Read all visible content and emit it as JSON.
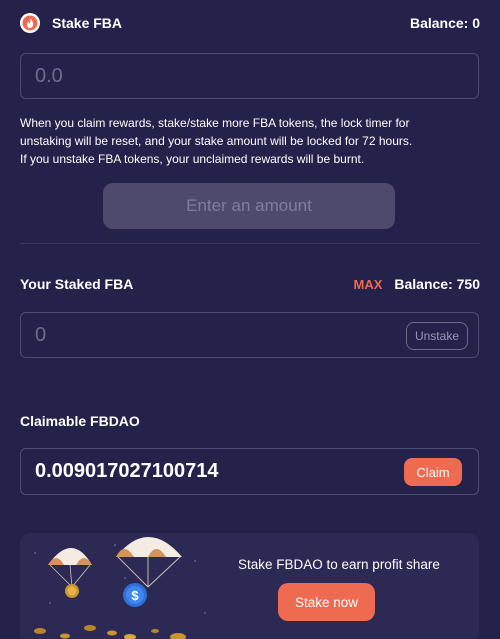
{
  "stake": {
    "title": "Stake FBA",
    "balance_label": "Balance: 0",
    "input_placeholder": "0.0",
    "input_value": "",
    "description": [
      "When you claim rewards, stake/stake more FBA tokens, the lock timer for",
      "unstaking will be reset, and your stake amount will be locked for 72 hours.",
      "If you unstake FBA tokens, your unclaimed rewards will be burnt."
    ],
    "enter_button_label": "Enter an amount"
  },
  "staked": {
    "label": "Your Staked FBA",
    "max_label": "MAX",
    "balance_label": "Balance: 750",
    "input_placeholder": "0",
    "input_value": "",
    "unstake_label": "Unstake"
  },
  "claimable": {
    "label": "Claimable FBDAO",
    "value": "0.009017027100714",
    "claim_label": "Claim"
  },
  "promo": {
    "text": "Stake FBDAO to earn profit share",
    "button_label": "Stake now"
  },
  "icons": {
    "logo": "flame-logo-icon",
    "parachute": "parachute-icon",
    "coin": "dollar-coin-icon"
  },
  "colors": {
    "background": "#24224a",
    "accent": "#ee6a50",
    "border": "#4e4b73",
    "disabled_button": "#4d4a6e",
    "promo_background": "#2c2955"
  }
}
